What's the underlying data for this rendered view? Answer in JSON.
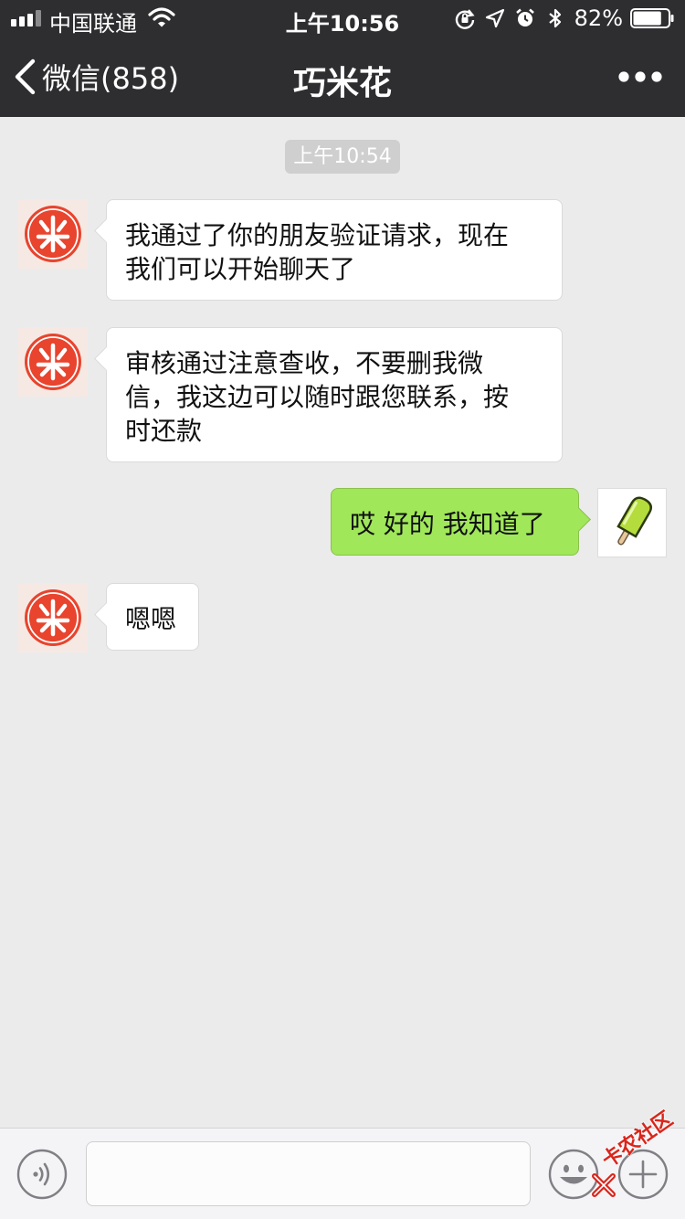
{
  "status_bar": {
    "carrier": "中国联通",
    "time": "上午10:56",
    "battery_percent": "82%",
    "battery_level": 0.82,
    "icons": [
      "signal-icon",
      "wifi-icon",
      "rotation-lock-icon",
      "location-arrow-icon",
      "alarm-clock-icon",
      "bluetooth-icon",
      "battery-icon"
    ]
  },
  "nav": {
    "back_label": "微信(858)",
    "title": "巧米花",
    "more_icon": "more-dots-icon"
  },
  "chat": {
    "timestamp": "上午10:54",
    "messages": [
      {
        "from": "contact",
        "lines": [
          "我通过了你的朋友验证请求，现在",
          "我们可以开始聊天了"
        ]
      },
      {
        "from": "contact",
        "lines": [
          "审核通过注意查收，不要删我微",
          "信，我这边可以随时跟您联系，按",
          "时还款"
        ]
      },
      {
        "from": "me",
        "lines": [
          "哎 好的 我知道了"
        ]
      },
      {
        "from": "contact",
        "lines": [
          "嗯嗯"
        ]
      }
    ]
  },
  "toolbar": {
    "input_value": "",
    "icons": [
      "voice-icon",
      "emoji-icon",
      "plus-icon"
    ]
  },
  "watermark": {
    "text": "卡农社区"
  },
  "colors": {
    "header_bg": "#2e2e31",
    "chat_bg": "#ebebeb",
    "bubble_out": "#a0e75a",
    "bubble_in": "#ffffff",
    "avatar_red": "#e8442e"
  }
}
